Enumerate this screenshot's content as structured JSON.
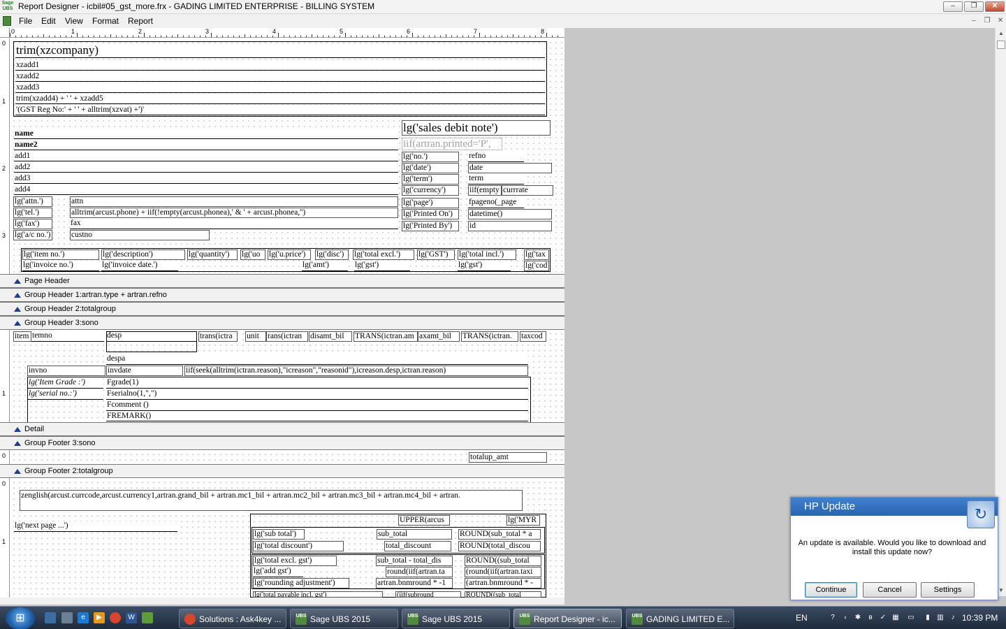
{
  "window": {
    "app_logo": "Sage UBS",
    "title": "Report Designer - icbil#05_gst_more.frx - GADING LIMITED ENTERPRISE - BILLING SYSTEM",
    "minimize": "–",
    "restore": "❐",
    "close": "✕"
  },
  "menu": [
    "File",
    "Edit",
    "View",
    "Format",
    "Report"
  ],
  "mdi": {
    "minimize": "–",
    "restore": "❐",
    "close": "✕"
  },
  "ruler": {
    "numbers": [
      "0",
      "1",
      "2",
      "3",
      "4",
      "5",
      "6",
      "7",
      "8"
    ]
  },
  "bands": {
    "page_header": "Page Header",
    "group_header_1": "Group Header 1:artran.type +  artran.refno",
    "group_header_2": "Group Header 2:totalgroup",
    "group_header_3": "Group Header 3:sono",
    "detail": "Detail",
    "group_footer_3": "Group Footer 3:sono",
    "group_footer_2": "Group Footer 2:totalgroup"
  },
  "vruler": {
    "page_header": [
      "0",
      "1",
      "2",
      "3"
    ],
    "detail": [
      "1"
    ],
    "gf3": [
      "0"
    ],
    "gf2": [
      "0",
      "1"
    ]
  },
  "page_header": {
    "company": "trim(xzcompany)",
    "addr1": "xzadd1",
    "addr2": "xzadd2",
    "addr3": "xzadd3",
    "addr4": "trim(xzadd4) + ' ' + xzadd5",
    "gst_reg": "'(GST Reg No:' + ' ' + alltrim(xzvat) +')'",
    "name": "name",
    "name2": "name2",
    "add1": "add1",
    "add2": "add2",
    "add3": "add3",
    "add4": "add4",
    "lg_attn": "lg('attn.')",
    "lg_tel": "lg('tel.')",
    "lg_fax": "lg('fax')",
    "lg_acno": "lg('a/c no.')",
    "attn": "attn",
    "phone": "alltrim(arcust.phone) + iif(!empty(arcust.phonea),' & ' + arcust.phonea,'')",
    "fax": "fax",
    "custno": "custno",
    "doc_title": "lg('sales debit note')",
    "printed": "iif(artran.printed='P',",
    "lg_no": "lg('no.')",
    "lg_date": "lg('date')",
    "lg_term": "lg('term')",
    "lg_currency": "lg('currency')",
    "lg_page": "lg('page')",
    "lg_printed_on": "lg('Printed On')",
    "lg_printed_by": "lg('Printed By')",
    "refno": "refno",
    "date": "date",
    "term": "term",
    "iif_empty": "iif(empty",
    "currrate": "currrate",
    "fpageno": "fpageno(_page",
    "datetime": "datetime()",
    "id": "id",
    "col_item_no": "lg('item no.')",
    "col_description": "lg('description')",
    "col_quantity": "lg('quantity')",
    "col_uom": "lg('uo",
    "col_uprice": "lg('u.price')",
    "col_disc": "lg('disc')",
    "col_total_excl": "lg('total excl.')",
    "col_gst": "lg('GST')",
    "col_total_incl": "lg('total incl.')",
    "col_tax": "lg('tax",
    "col_invoice_no": "lg('invoice no.')",
    "col_invoice_date": "lg('invoice date.')",
    "col_amt": "lg('amt')",
    "col_gst2": "lg('gst')",
    "col_gst3": "lg('gst')",
    "col_cod": "lg('cod"
  },
  "detail": {
    "item": "item",
    "itemno": "temno",
    "desp": "desp",
    "trans_qty": "trans(ictra",
    "unit": "unit",
    "trans_price": "rans(ictran",
    "disamt": "disamt_bil",
    "trans_amt": "TRANS(ictran.am",
    "taxamt": "axamt_bil",
    "trans_tax": "TRANS(ictran.",
    "taxcode": "taxcod",
    "despa": "despa",
    "invno": "invno",
    "invdate": "invdate",
    "reason": "iif(seek(alltrim(ictran.reason),\"icreason\",\"reasonid\"),icreason.desp,ictran.reason)",
    "lg_item_grade": "lg('Item Grade :')",
    "lg_serial": "lg('serial no.:')",
    "fgrade": "Fgrade(1)",
    "fserial": "Fserialno(1,\",\")",
    "fcomment": "Fcomment ()",
    "fremark": "FREMARK()"
  },
  "gf3": {
    "totalup": "totalup_amt"
  },
  "gf2": {
    "zenglish": "zenglish(arcust.currcode,arcust.currency1,artran.grand_bil +  artran.mc1_bil +  artran.mc2_bil + artran.mc3_bil + artran.mc4_bil + artran.",
    "next_page": "lg('next page ...')",
    "upper": "UPPER(arcus",
    "myr": "lg('MYR",
    "lg_sub_total": "lg('sub total')",
    "sub_total": "sub_total",
    "round_sub": "ROUND(sub_total * a",
    "lg_total_discount": "lg('total discount')",
    "total_discount": "total_discount",
    "round_total": "ROUND(total_discou",
    "lg_total_excl_gst": "lg('total excl. gst')",
    "sub_total_dis": "sub_total - total_dis",
    "round_sub2": "ROUND((sub_total",
    "lg_add_gst": "lg('add gst')",
    "round_iif": "round(iif(artran.ta",
    "round_iif2": "(round(iif(artran.taxi",
    "lg_rounding": "lg('rounding adjustment')",
    "bnmround": "artran.bnmround * -1",
    "bnmround2": "(artran.bnmround * -",
    "total_payable": "lg('total payable incl. gst')",
    "iif_sub": "(iif(subround",
    "round_sub3": "ROUND((sub_total"
  },
  "popup": {
    "title": "HP Update",
    "message": "An update is available. Would you like to download and install this update now?",
    "continue": "Continue",
    "cancel": "Cancel",
    "settings": "Settings"
  },
  "taskbar": {
    "items": [
      "Solutions : Ask4key ...",
      "Sage UBS 2015",
      "Sage UBS 2015",
      "Report Designer - ic...",
      "GADING LIMITED E..."
    ],
    "lang": "EN",
    "clock": "10:39 PM"
  }
}
